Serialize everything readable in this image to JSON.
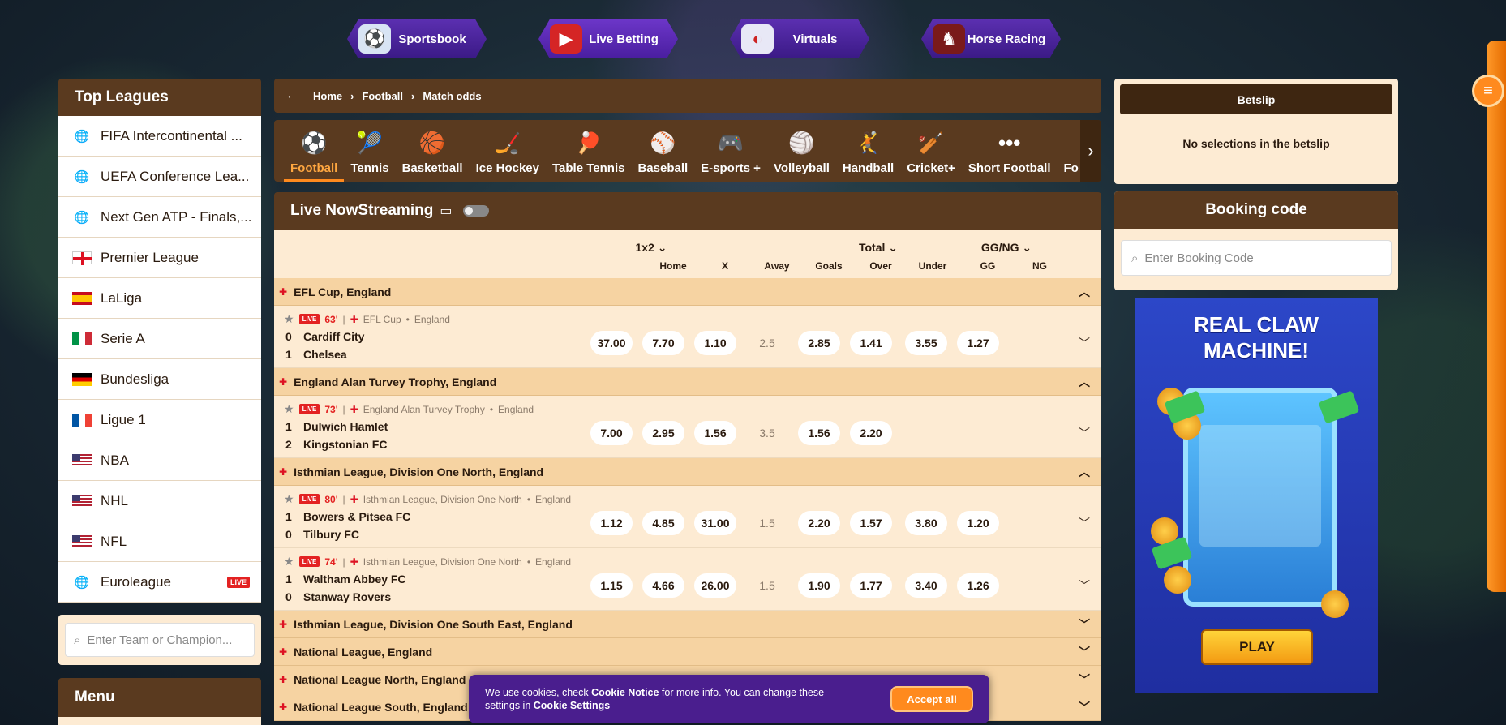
{
  "nav": {
    "items": [
      {
        "label": "Sportsbook",
        "icon": "soccer-ball-icon"
      },
      {
        "label": "Live Betting",
        "icon": "live-play-icon"
      },
      {
        "label": "Virtuals",
        "icon": "vr-goggles-icon"
      },
      {
        "label": "Horse Racing",
        "icon": "horse-icon"
      }
    ],
    "active": "Live Betting"
  },
  "left": {
    "top_leagues_title": "Top Leagues",
    "leagues": [
      {
        "label": "FIFA Intercontinental ...",
        "flag": "globe"
      },
      {
        "label": "UEFA Conference Lea...",
        "flag": "globe"
      },
      {
        "label": "Next Gen ATP - Finals,...",
        "flag": "globe"
      },
      {
        "label": "Premier League",
        "flag": "england"
      },
      {
        "label": "LaLiga",
        "flag": "spain"
      },
      {
        "label": "Serie A",
        "flag": "italy"
      },
      {
        "label": "Bundesliga",
        "flag": "germany"
      },
      {
        "label": "Ligue 1",
        "flag": "france"
      },
      {
        "label": "NBA",
        "flag": "usa"
      },
      {
        "label": "NHL",
        "flag": "usa"
      },
      {
        "label": "NFL",
        "flag": "usa"
      },
      {
        "label": "Euroleague",
        "flag": "globe",
        "badge": "LIVE"
      }
    ],
    "search_placeholder": "Enter Team or Champion...",
    "menu_title": "Menu"
  },
  "breadcrumb": [
    "Home",
    "Football",
    "Match odds"
  ],
  "sports": [
    {
      "label": "Football",
      "icon": "⚽",
      "active": true
    },
    {
      "label": "Tennis",
      "icon": "🎾"
    },
    {
      "label": "Basketball",
      "icon": "🏀"
    },
    {
      "label": "Ice Hockey",
      "icon": "🏒"
    },
    {
      "label": "Table Tennis",
      "icon": "🏓"
    },
    {
      "label": "Baseball",
      "icon": "⚾"
    },
    {
      "label": "E-sports +",
      "icon": "🎮"
    },
    {
      "label": "Volleyball",
      "icon": "🏐"
    },
    {
      "label": "Handball",
      "icon": "🤾"
    },
    {
      "label": "Cricket+",
      "icon": "🏏"
    },
    {
      "label": "Short Football",
      "icon": "•••"
    },
    {
      "label": "Fo",
      "icon": ""
    }
  ],
  "live": {
    "title": "Live NowStreaming"
  },
  "markets": {
    "groups": [
      {
        "label": "1x2",
        "chev": "⌄"
      },
      {
        "label": "Total",
        "chev": "⌄"
      },
      {
        "label": "GG/NG",
        "chev": "⌄"
      }
    ],
    "cols": [
      "Home",
      "X",
      "Away",
      "Goals",
      "Over",
      "Under",
      "GG",
      "NG"
    ]
  },
  "competitions": [
    {
      "name": "EFL Cup, England",
      "expanded": true,
      "matches": [
        {
          "minute": "63'",
          "competition": "EFL Cup",
          "country": "England",
          "home": {
            "score": "0",
            "name": "Cardiff City"
          },
          "away": {
            "score": "1",
            "name": "Chelsea"
          },
          "odds": [
            "37.00",
            "7.70",
            "1.10"
          ],
          "goals": "2.5",
          "ou": [
            "2.85",
            "1.41"
          ],
          "ggng": [
            "3.55",
            "1.27"
          ]
        }
      ]
    },
    {
      "name": "England Alan Turvey Trophy, England",
      "expanded": true,
      "matches": [
        {
          "minute": "73'",
          "competition": "England Alan Turvey Trophy",
          "country": "England",
          "home": {
            "score": "1",
            "name": "Dulwich Hamlet"
          },
          "away": {
            "score": "2",
            "name": "Kingstonian FC"
          },
          "odds": [
            "7.00",
            "2.95",
            "1.56"
          ],
          "goals": "3.5",
          "ou": [
            "1.56",
            "2.20"
          ],
          "ggng": [
            "",
            ""
          ]
        }
      ]
    },
    {
      "name": "Isthmian League, Division One North, England",
      "expanded": true,
      "matches": [
        {
          "minute": "80'",
          "competition": "Isthmian League, Division One North",
          "country": "England",
          "home": {
            "score": "1",
            "name": "Bowers & Pitsea FC"
          },
          "away": {
            "score": "0",
            "name": "Tilbury FC"
          },
          "odds": [
            "1.12",
            "4.85",
            "31.00"
          ],
          "goals": "1.5",
          "ou": [
            "2.20",
            "1.57"
          ],
          "ggng": [
            "3.80",
            "1.20"
          ]
        },
        {
          "minute": "74'",
          "competition": "Isthmian League, Division One North",
          "country": "England",
          "home": {
            "score": "1",
            "name": "Waltham Abbey FC"
          },
          "away": {
            "score": "0",
            "name": "Stanway Rovers"
          },
          "odds": [
            "1.15",
            "4.66",
            "26.00"
          ],
          "goals": "1.5",
          "ou": [
            "1.90",
            "1.77"
          ],
          "ggng": [
            "3.40",
            "1.26"
          ]
        }
      ]
    },
    {
      "name": "Isthmian League, Division One South East, England",
      "expanded": false,
      "matches": []
    },
    {
      "name": "National League, England",
      "expanded": false,
      "matches": []
    },
    {
      "name": "National League North, England",
      "expanded": false,
      "matches": []
    },
    {
      "name": "National League South, England",
      "expanded": false,
      "matches": []
    }
  ],
  "betslip": {
    "title": "Betslip",
    "empty": "No selections in the betslip"
  },
  "booking": {
    "title": "Booking code",
    "placeholder": "Enter Booking Code"
  },
  "ad": {
    "line1": "REAL CLAW",
    "line2": "MACHINE!",
    "play": "PLAY"
  },
  "cookie": {
    "text_before": "We use cookies, check ",
    "notice_link": "Cookie Notice",
    "text_mid": " for more info. You can change these settings in ",
    "settings_link": "Cookie Settings",
    "accept": "Accept all"
  }
}
